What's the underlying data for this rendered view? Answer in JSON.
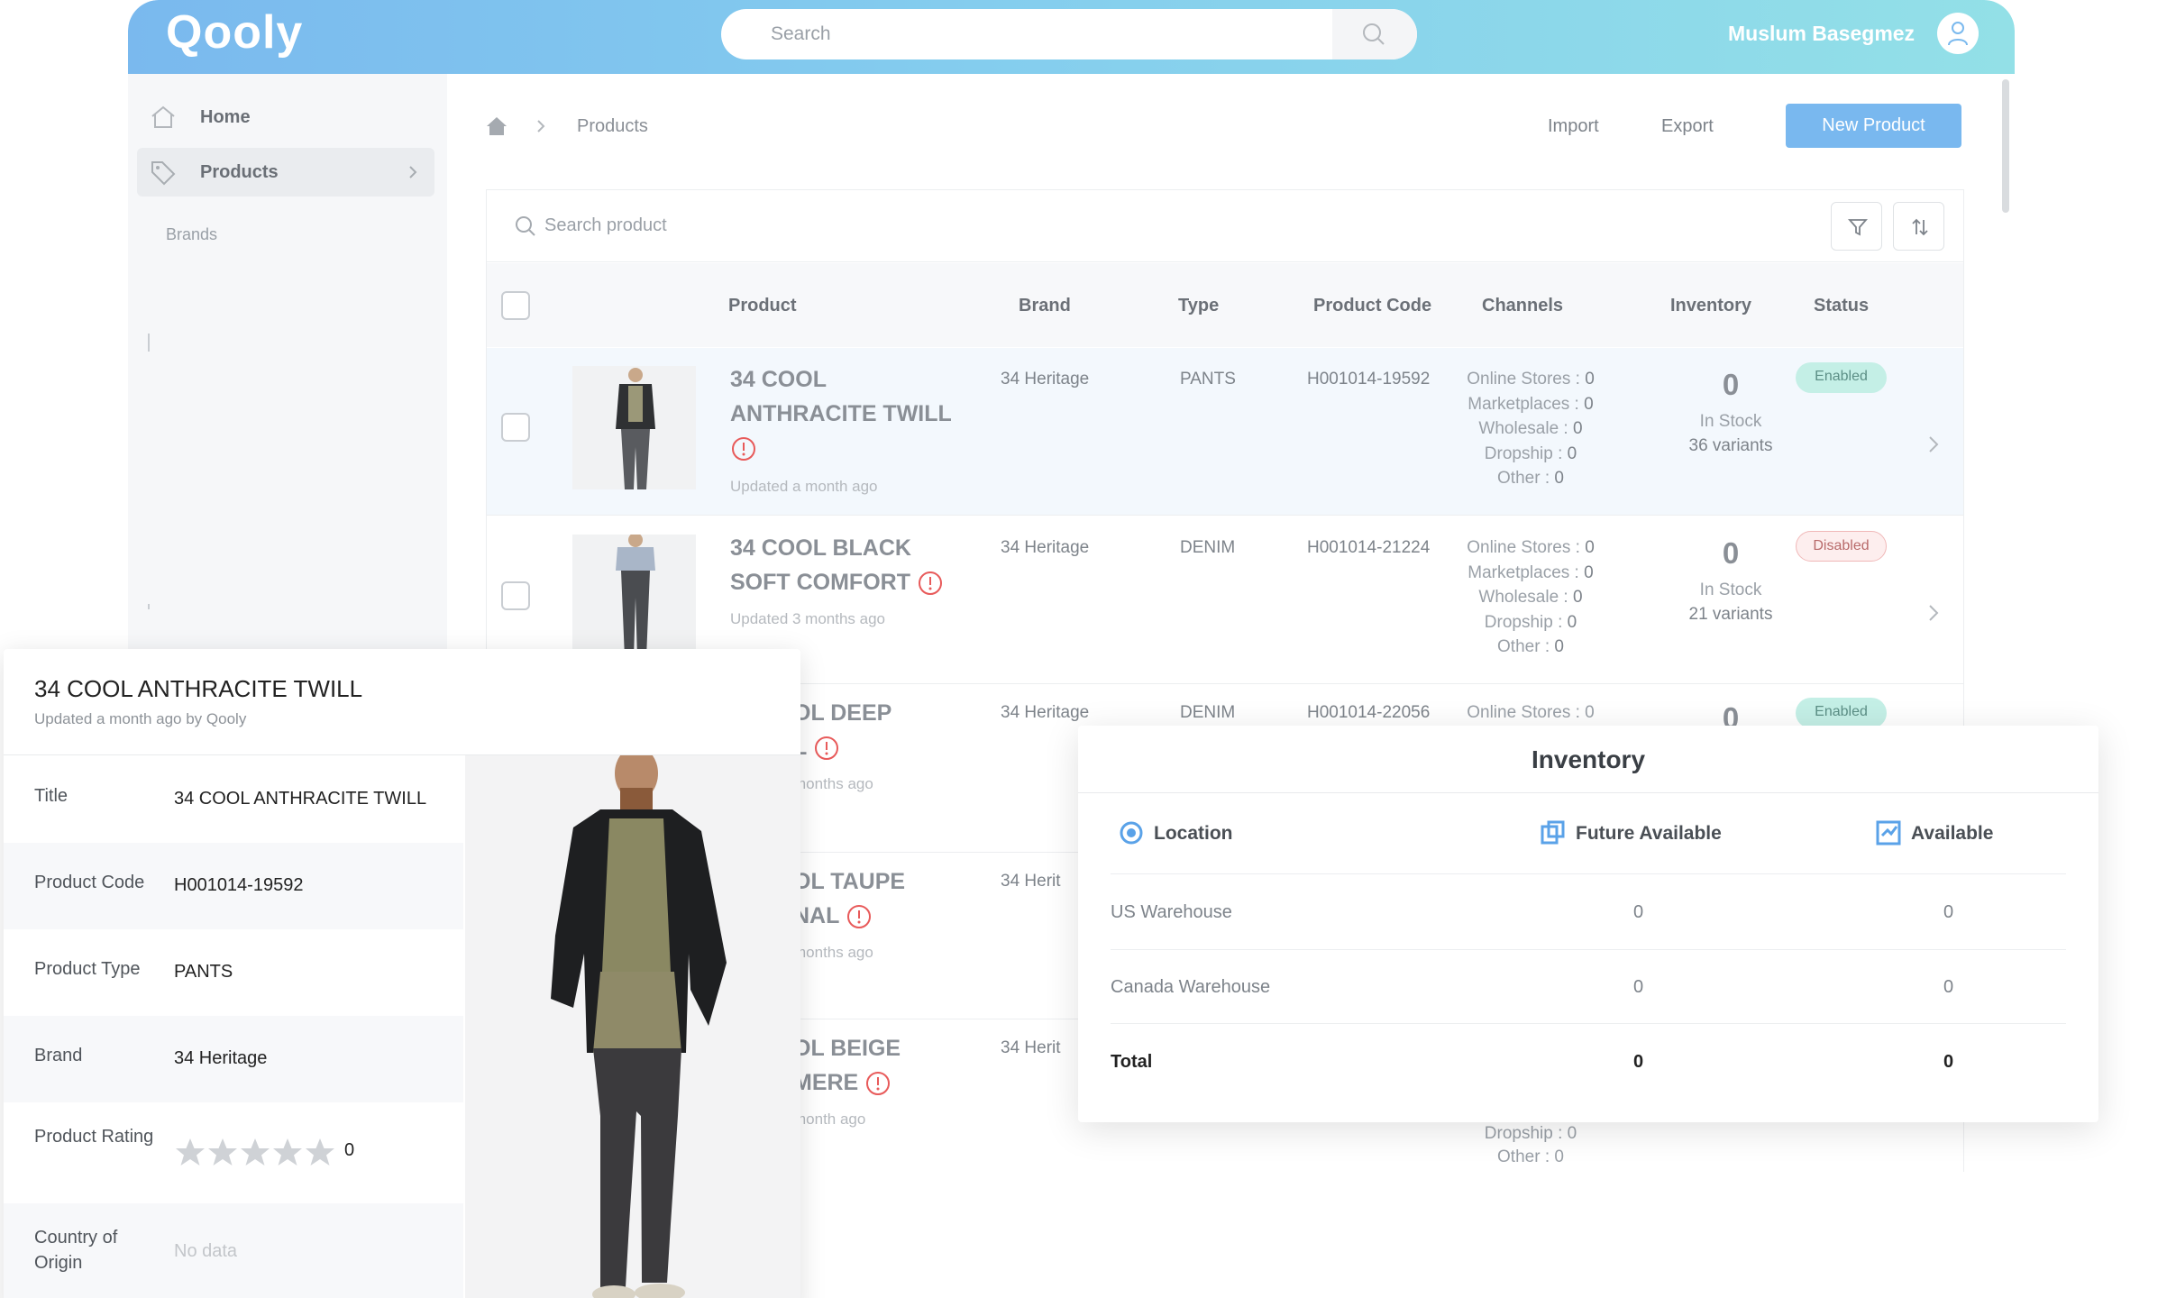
{
  "header": {
    "logo": "Qooly",
    "search_placeholder": "Search",
    "user_name": "Muslum Basegmez"
  },
  "sidebar": {
    "items": [
      {
        "label": "Home",
        "icon": "home-icon"
      },
      {
        "label": "Products",
        "icon": "tag-icon"
      }
    ],
    "sub_item": "Brands"
  },
  "breadcrumb": {
    "current": "Products"
  },
  "actions": {
    "import": "Import",
    "export": "Export",
    "new_product": "New Product"
  },
  "table": {
    "search_placeholder": "Search product",
    "columns": [
      "Product",
      "Brand",
      "Type",
      "Product Code",
      "Channels",
      "Inventory",
      "Status"
    ],
    "channel_labels": [
      "Online Stores",
      "Marketplaces",
      "Wholesale",
      "Dropship",
      "Other"
    ],
    "rows": [
      {
        "name": "34 COOL ANTHRACITE TWILL",
        "updated": "Updated a month ago",
        "brand": "34 Heritage",
        "type": "PANTS",
        "code": "H001014-19592",
        "channels": [
          "0",
          "0",
          "0",
          "0",
          "0"
        ],
        "inventory": "0",
        "stock_label": "In Stock",
        "variants": "36 variants",
        "status": "Enabled"
      },
      {
        "name": "34 COOL BLACK SOFT COMFORT",
        "updated": "Updated 3 months ago",
        "brand": "34 Heritage",
        "type": "DENIM",
        "code": "H001014-21224",
        "channels": [
          "0",
          "0",
          "0",
          "0",
          "0"
        ],
        "inventory": "0",
        "stock_label": "In Stock",
        "variants": "21 variants",
        "status": "Disabled"
      },
      {
        "name_fragment_1": "OL DEEP",
        "name_fragment_2": "L",
        "updated": "months ago",
        "brand": "34 Heritage",
        "type": "DENIM",
        "code": "H001014-22056",
        "channels_first": "Online Stores : 0",
        "inventory": "0",
        "status": "Enabled"
      },
      {
        "name_fragment_1": "OL TAUPE",
        "name_fragment_2": "NAL",
        "updated": "months ago",
        "brand": "34 Herit"
      },
      {
        "name_fragment_1": "OL BEIGE",
        "name_fragment_2": "MERE",
        "updated": "month ago",
        "brand": "34 Herit",
        "dropship": "Dropship : 0",
        "other": "Other : 0"
      }
    ]
  },
  "detail_panel": {
    "title": "34 COOL ANTHRACITE TWILL",
    "subtitle": "Updated a month ago by Qooly",
    "fields": [
      {
        "label": "Title",
        "value": "34 COOL ANTHRACITE TWILL"
      },
      {
        "label": "Product Code",
        "value": "H001014-19592"
      },
      {
        "label": "Product Type",
        "value": "PANTS"
      },
      {
        "label": "Brand",
        "value": "34 Heritage"
      },
      {
        "label": "Product Rating",
        "value": "0",
        "stars": 0
      },
      {
        "label": "Country of Origin",
        "value": "No data"
      }
    ]
  },
  "inventory_popup": {
    "title": "Inventory",
    "columns": [
      "Location",
      "Future Available",
      "Available"
    ],
    "rows": [
      {
        "location": "US Warehouse",
        "future": "0",
        "available": "0"
      },
      {
        "location": "Canada Warehouse",
        "future": "0",
        "available": "0"
      },
      {
        "location": "Total",
        "future": "0",
        "available": "0"
      }
    ]
  },
  "colors": {
    "accent": "#79b8ef",
    "enabled_badge": "#c4efe6",
    "disabled_badge": "#fdeeee",
    "warning": "#e85a5a"
  }
}
